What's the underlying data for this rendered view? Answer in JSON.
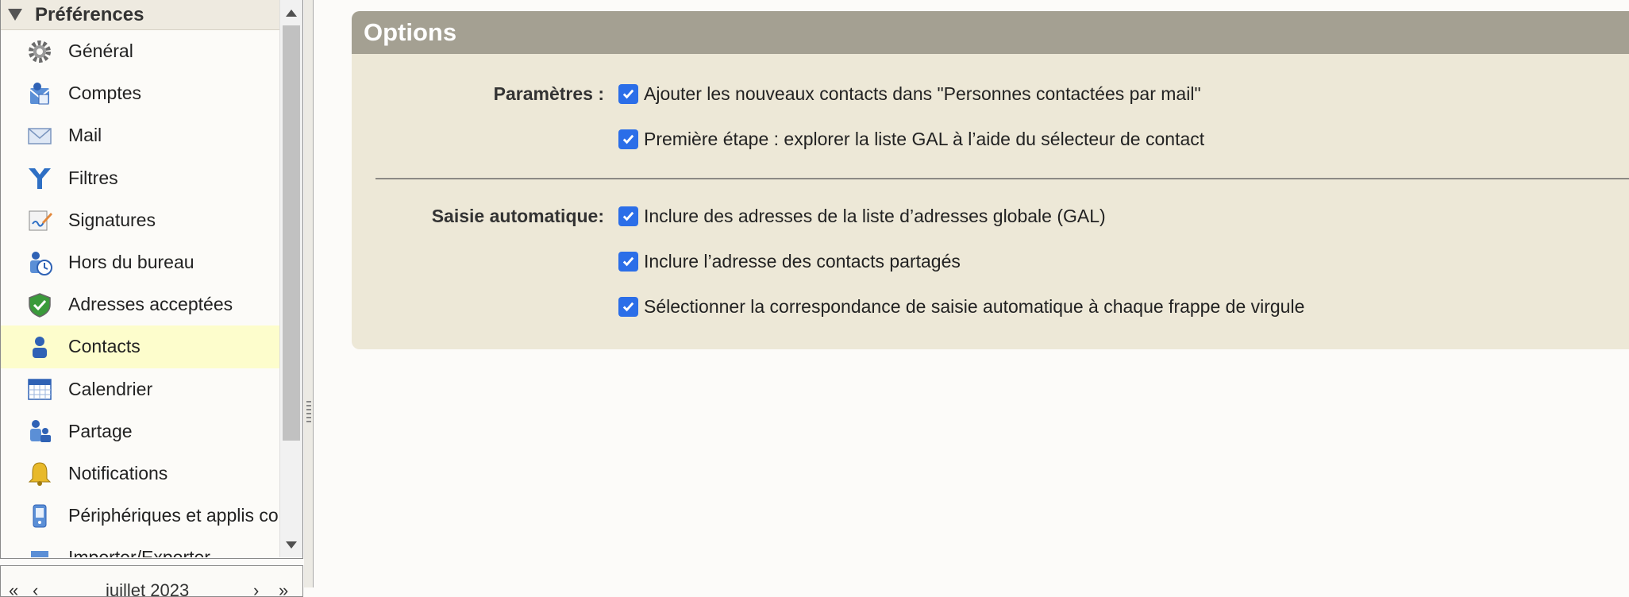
{
  "sidebar": {
    "title": "Préférences",
    "items": [
      {
        "label": "Général",
        "icon": "gear-icon"
      },
      {
        "label": "Comptes",
        "icon": "accounts-icon"
      },
      {
        "label": "Mail",
        "icon": "envelope-icon"
      },
      {
        "label": "Filtres",
        "icon": "filter-icon"
      },
      {
        "label": "Signatures",
        "icon": "signature-icon"
      },
      {
        "label": "Hors du bureau",
        "icon": "out-of-office-icon"
      },
      {
        "label": "Adresses acceptées",
        "icon": "shield-check-icon"
      },
      {
        "label": "Contacts",
        "icon": "contact-person-icon",
        "selected": true
      },
      {
        "label": "Calendrier",
        "icon": "calendar-icon"
      },
      {
        "label": "Partage",
        "icon": "sharing-icon"
      },
      {
        "label": "Notifications",
        "icon": "bell-icon"
      },
      {
        "label": "Périphériques et applis co",
        "icon": "mobile-device-icon"
      },
      {
        "label": "Importer/Exporter",
        "icon": "import-export-icon"
      }
    ]
  },
  "mini_calendar": {
    "prev_year": "«",
    "prev_month": "‹",
    "month_label": "juillet 2023",
    "next_month": "›",
    "next_year": "»"
  },
  "options": {
    "title": "Options",
    "sections": [
      {
        "label": "Paramètres :",
        "checkboxes": [
          {
            "text": "Ajouter les nouveaux contacts dans \"Personnes contactées par mail\"",
            "checked": true
          },
          {
            "text": "Première étape : explorer la liste GAL à l’aide du sélecteur de contact",
            "checked": true
          }
        ]
      },
      {
        "label": "Saisie automatique:",
        "checkboxes": [
          {
            "text": "Inclure des adresses de la liste d’adresses globale (GAL)",
            "checked": true
          },
          {
            "text": "Inclure l’adresse des contacts partagés",
            "checked": true
          },
          {
            "text": "Sélectionner la correspondance de saisie automatique à chaque frappe de virgule",
            "checked": true
          }
        ]
      }
    ]
  },
  "colors": {
    "panel_header": "#a4a092",
    "panel_body": "#ede8d7",
    "selected_item": "#fdfdcc",
    "checkbox": "#2b6ee8"
  }
}
